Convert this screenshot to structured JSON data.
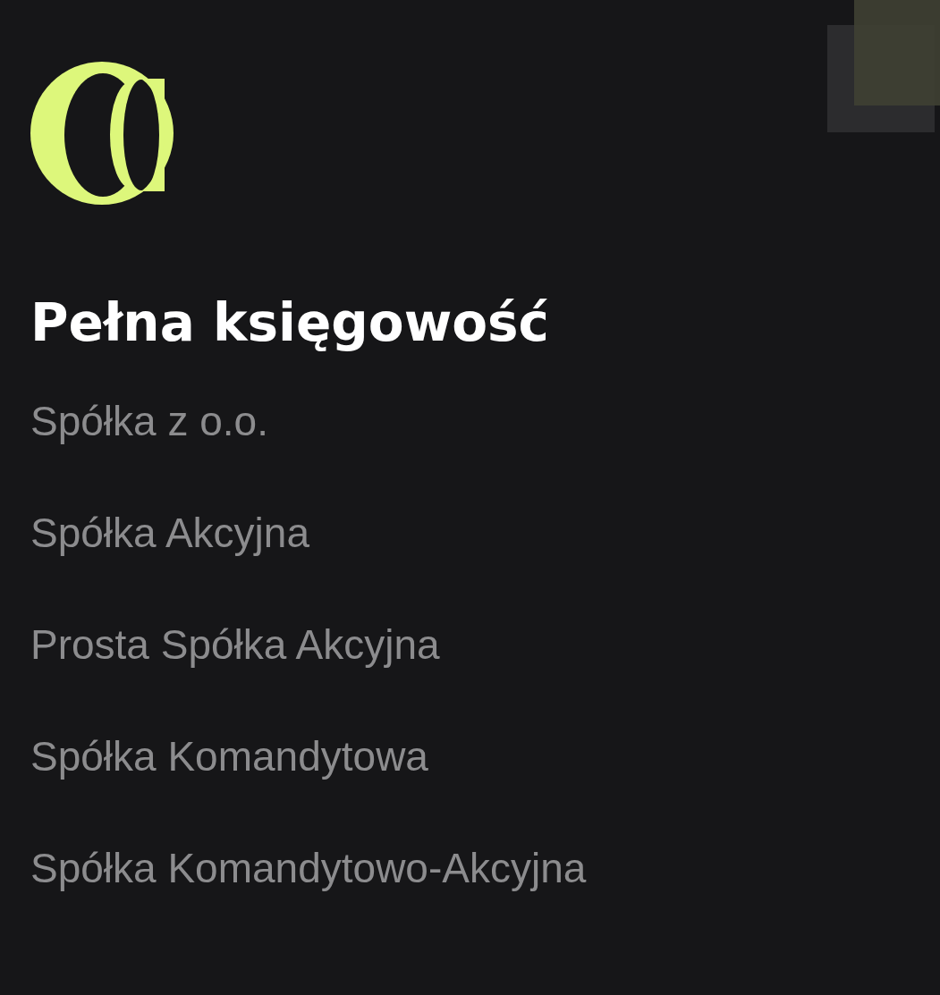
{
  "heading": "Pełna księgowość",
  "menu_items": [
    {
      "label": "Spółka z o.o."
    },
    {
      "label": "Spółka Akcyjna"
    },
    {
      "label": "Prosta Spółka Akcyjna"
    },
    {
      "label": "Spółka Komandytowa"
    },
    {
      "label": "Spółka Komandytowo-Akcyjna"
    }
  ]
}
